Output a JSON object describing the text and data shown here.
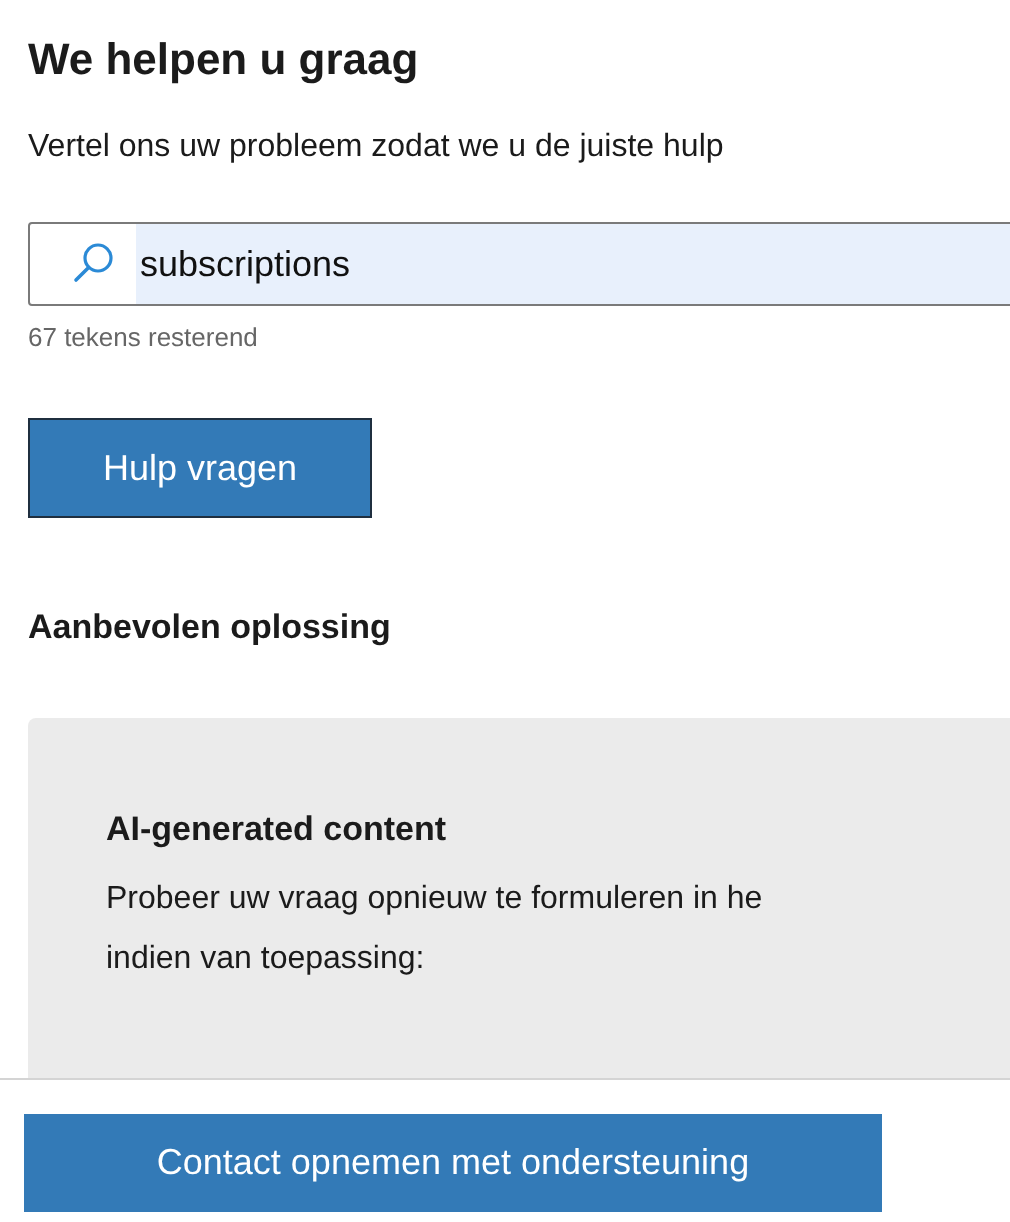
{
  "title": "We helpen u graag",
  "intro": "Vertel ons uw probleem zodat we u de juiste hulp",
  "search": {
    "value": "subscriptions",
    "text_selected": true,
    "counter": "67 tekens resterend"
  },
  "ask_button": "Hulp vragen",
  "recommended": {
    "heading": "Aanbevolen oplossing",
    "card": {
      "title": "AI-generated content",
      "lines": [
        "Probeer uw vraag opnieuw te formuleren in he",
        "indien van toepassing:"
      ]
    }
  },
  "footer_button": "Contact opnemen met ondersteuning"
}
